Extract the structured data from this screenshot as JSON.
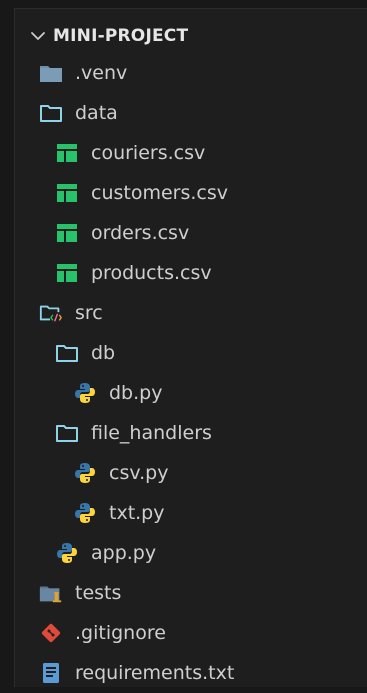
{
  "explorer": {
    "title": "MINI-PROJECT",
    "items": [
      {
        "label": ".venv"
      },
      {
        "label": "data"
      },
      {
        "label": "couriers.csv"
      },
      {
        "label": "customers.csv"
      },
      {
        "label": "orders.csv"
      },
      {
        "label": "products.csv"
      },
      {
        "label": "src"
      },
      {
        "label": "db"
      },
      {
        "label": "db.py"
      },
      {
        "label": "file_handlers"
      },
      {
        "label": "csv.py"
      },
      {
        "label": "txt.py"
      },
      {
        "label": "app.py"
      },
      {
        "label": "tests"
      },
      {
        "label": ".gitignore"
      },
      {
        "label": "requirements.txt"
      }
    ]
  },
  "colors": {
    "folder_outline": "#8fd3e8",
    "venv_folder": "#6f8fa8",
    "csv_green": "#27c26a",
    "python_blue": "#3776ab",
    "python_yellow": "#ffd43b",
    "git_red": "#e04a3a",
    "text_file_blue": "#5b9bd5",
    "tests_folder": "#5b7590",
    "tests_badge": "#e0a431"
  }
}
